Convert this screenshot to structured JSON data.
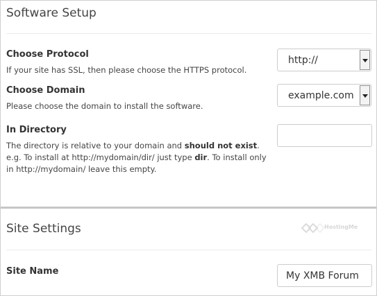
{
  "software_setup": {
    "title": "Software Setup",
    "protocol": {
      "label": "Choose Protocol",
      "description": "If your site has SSL, then please choose the HTTPS protocol.",
      "selected": "http://"
    },
    "domain": {
      "label": "Choose Domain",
      "description": "Please choose the domain to install the software.",
      "selected": "example.com"
    },
    "directory": {
      "label": "In Directory",
      "desc_part1": "The directory is relative to your domain and ",
      "desc_bold1": "should not exist",
      "desc_part2": ". e.g. To install at http://mydomain/dir/ just type ",
      "desc_bold2": "dir",
      "desc_part3": ". To install only in http://mydomain/ leave this empty.",
      "value": ""
    }
  },
  "site_settings": {
    "title": "Site Settings",
    "watermark": "HostingMe",
    "site_name": {
      "label": "Site Name",
      "value": "My XMB Forum"
    }
  },
  "icons": {
    "select_arrow": "chevron-down-icon",
    "logo": "hostingme-logo-icon"
  }
}
